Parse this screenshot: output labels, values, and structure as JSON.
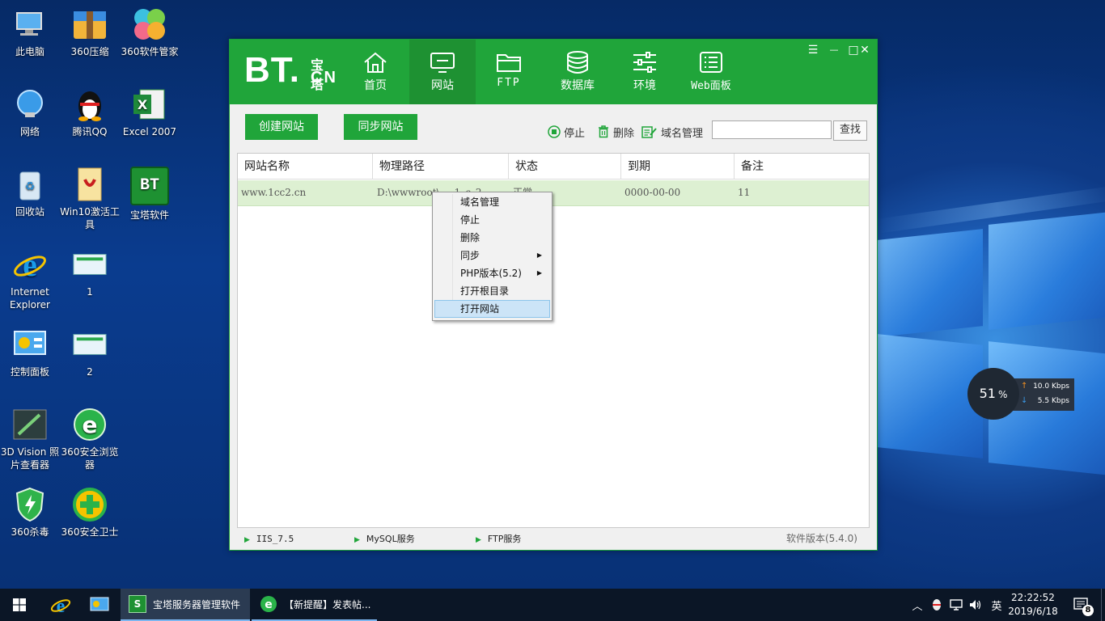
{
  "desktop": {
    "icons": [
      {
        "label": "此电脑"
      },
      {
        "label": "360压缩"
      },
      {
        "label": "360软件管家"
      },
      {
        "label": "网络"
      },
      {
        "label": "腾讯QQ"
      },
      {
        "label": "Excel 2007"
      },
      {
        "label": "回收站"
      },
      {
        "label": "Win10激活工具"
      },
      {
        "label": "宝塔软件"
      },
      {
        "label": "Internet Explorer"
      },
      {
        "label": "1"
      },
      {
        "label": "控制面板"
      },
      {
        "label": "2"
      },
      {
        "label": "3D Vision 照片查看器"
      },
      {
        "label": "360安全浏览器"
      },
      {
        "label": "360杀毒"
      },
      {
        "label": "360安全卫士"
      }
    ],
    "bt_icon_text": "BT"
  },
  "app": {
    "logo": {
      "bt": "BT.",
      "cn_top": "宝塔",
      "cn_bottom": "CN"
    },
    "nav": [
      {
        "label": "首页",
        "icon": "home-icon"
      },
      {
        "label": "网站",
        "icon": "monitor-icon"
      },
      {
        "label": "FTP",
        "icon": "folder-icon"
      },
      {
        "label": "数据库",
        "icon": "database-icon"
      },
      {
        "label": "环境",
        "icon": "sliders-icon"
      },
      {
        "label": "Web面板",
        "icon": "list-panel-icon"
      }
    ],
    "window_controls": {
      "menu": "☰",
      "minimize": "—",
      "maximize": "□",
      "close": "✕"
    },
    "toolbar": {
      "create_site": "创建网站",
      "sync_site": "同步网站",
      "stop": "停止",
      "delete": "删除",
      "domain_manage": "域名管理",
      "search_value": "",
      "search_button": "查找"
    },
    "table": {
      "headers": [
        "网站名称",
        "物理路径",
        "状态",
        "到期",
        "备注"
      ],
      "rows": [
        {
          "name": "www.1cc2.cn",
          "path": "D:\\wwwroot\\",
          "path_tail": "1c2",
          "status": "正常",
          "expire": "0000-00-00",
          "note": "11"
        }
      ]
    },
    "context_menu": [
      {
        "label": "域名管理"
      },
      {
        "label": "停止"
      },
      {
        "label": "删除"
      },
      {
        "label": "同步",
        "submenu": true
      },
      {
        "label": "PHP版本(5.2)",
        "submenu": true
      },
      {
        "label": "打开根目录"
      },
      {
        "label": "打开网站",
        "highlighted": true
      }
    ],
    "statusbar": {
      "iis": "IIS_7.5",
      "mysql": "MySQL服务",
      "ftp": "FTP服务",
      "version": "软件版本(5.4.0)"
    }
  },
  "net_widget": {
    "percent": "51",
    "percent_sign": "%",
    "up": "10.0 Kbps",
    "down": "5.5 Kbps"
  },
  "taskbar": {
    "tasks": [
      {
        "label": "宝塔服务器管理软件"
      },
      {
        "label": "【新提醒】发表帖..."
      }
    ],
    "tray": {
      "ime": "英",
      "time": "22:22:52",
      "date": "2019/6/18",
      "notifications": "8"
    }
  }
}
